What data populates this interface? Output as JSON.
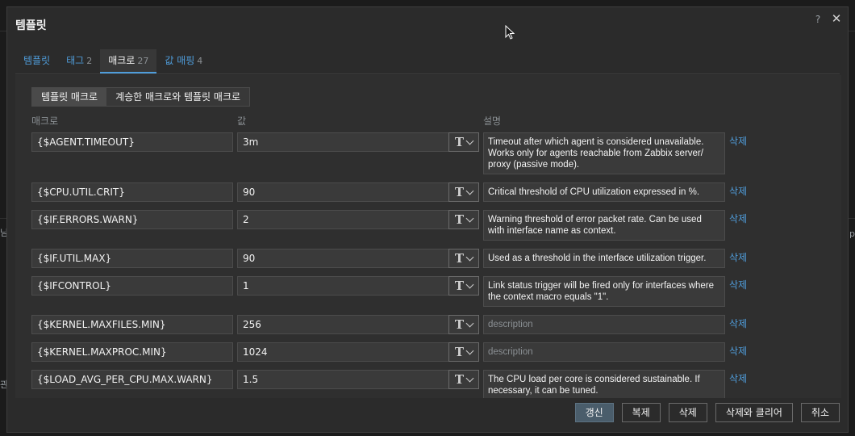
{
  "dialog": {
    "title": "템플릿",
    "help_icon": "?",
    "close_icon": "✕"
  },
  "tabs": [
    {
      "label": "템플릿",
      "count": "",
      "active": false
    },
    {
      "label": "태그",
      "count": "2",
      "active": false
    },
    {
      "label": "매크로",
      "count": "27",
      "active": true
    },
    {
      "label": "값 매핑",
      "count": "4",
      "active": false
    }
  ],
  "toggle": {
    "template_macros": "템플릿 매크로",
    "inherited_macros": "계승한 매크로와 템플릿 매크로"
  },
  "columns": {
    "macro": "매크로",
    "value": "값",
    "description": "설명"
  },
  "macros": [
    {
      "macro": "{$AGENT.TIMEOUT}",
      "value": "3m",
      "description": "Timeout after which agent is considered unavailable. Works only for agents reachable from Zabbix server/ proxy (passive mode).",
      "delete": "삭제"
    },
    {
      "macro": "{$CPU.UTIL.CRIT}",
      "value": "90",
      "description": "Critical threshold of CPU utilization expressed in %.",
      "delete": "삭제"
    },
    {
      "macro": "{$IF.ERRORS.WARN}",
      "value": "2",
      "description": "Warning threshold of error packet rate. Can be used with interface name as context.",
      "delete": "삭제"
    },
    {
      "macro": "{$IF.UTIL.MAX}",
      "value": "90",
      "description": "Used as a threshold in the interface utilization trigger.",
      "delete": "삭제"
    },
    {
      "macro": "{$IFCONTROL}",
      "value": "1",
      "description": "Link status trigger will be fired only for interfaces where the context macro equals \"1\".",
      "delete": "삭제"
    },
    {
      "macro": "{$KERNEL.MAXFILES.MIN}",
      "value": "256",
      "description": "description",
      "delete": "삭제"
    },
    {
      "macro": "{$KERNEL.MAXPROC.MIN}",
      "value": "1024",
      "description": "description",
      "delete": "삭제"
    },
    {
      "macro": "{$LOAD_AVG_PER_CPU.MAX.WARN}",
      "value": "1.5",
      "description": "The CPU load per core is considered sustainable. If necessary, it can be tuned.",
      "delete": "삭제"
    }
  ],
  "type_icon": "T",
  "footer": {
    "update": "갱신",
    "clone": "복제",
    "delete": "삭제",
    "delete_clear": "삭제와 클리어",
    "cancel": "취소"
  },
  "background": {
    "left_edge_1": "님",
    "left_edge_2": "관",
    "right_edge": "p"
  },
  "colors": {
    "link": "#4f9ddb",
    "dialog_bg": "#2b2b2b",
    "input_bg": "#3a3a3a",
    "primary_button": "#4a5d6b"
  }
}
